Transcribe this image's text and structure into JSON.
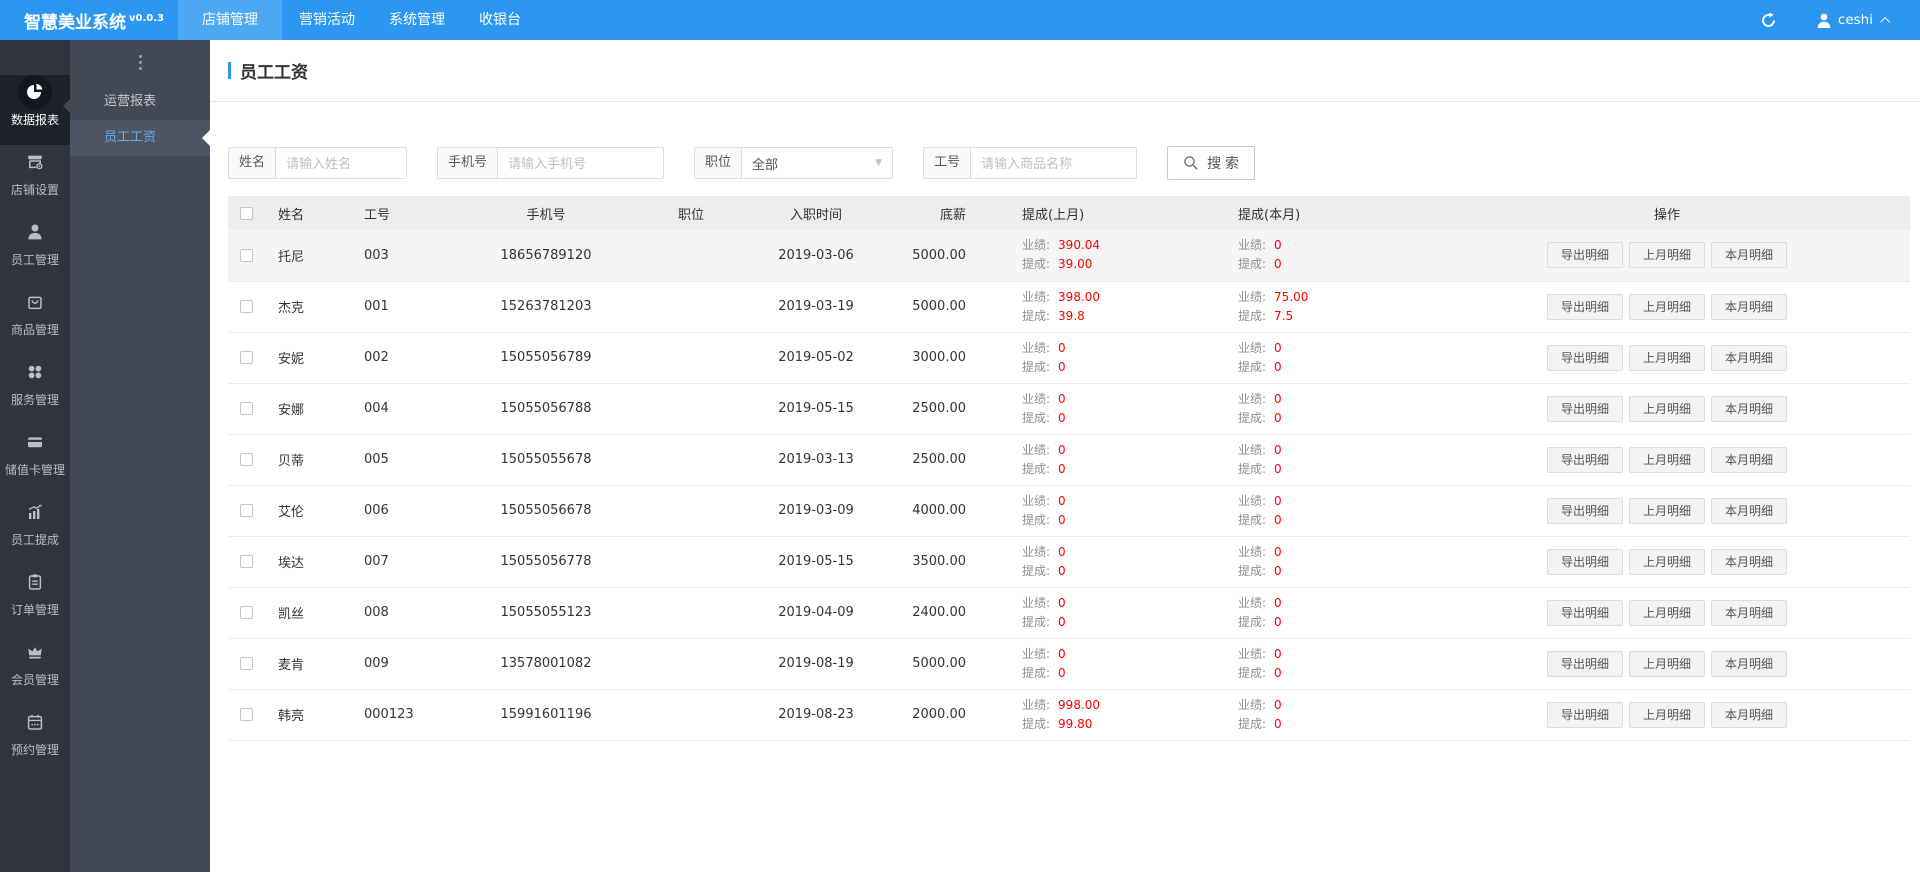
{
  "app": {
    "title": "智慧美业系统",
    "version": "v0.0.3"
  },
  "topnav": {
    "items": [
      {
        "label": "店铺管理",
        "active": true
      },
      {
        "label": "营销活动",
        "active": false
      },
      {
        "label": "系统管理",
        "active": false
      },
      {
        "label": "收银台",
        "active": false
      }
    ]
  },
  "user": {
    "name": "ceshi"
  },
  "sidebar": {
    "items": [
      {
        "label": "数据报表",
        "icon": "pie-chart-icon",
        "active": true
      },
      {
        "label": "店铺设置",
        "icon": "store-icon",
        "active": false
      },
      {
        "label": "员工管理",
        "icon": "staff-person-icon",
        "active": false
      },
      {
        "label": "商品管理",
        "icon": "goods-bag-icon",
        "active": false
      },
      {
        "label": "服务管理",
        "icon": "services-clover-icon",
        "active": false
      },
      {
        "label": "储值卡管理",
        "icon": "stored-card-icon",
        "active": false
      },
      {
        "label": "员工提成",
        "icon": "commission-chart-icon",
        "active": false
      },
      {
        "label": "订单管理",
        "icon": "order-clipboard-icon",
        "active": false
      },
      {
        "label": "会员管理",
        "icon": "member-crown-icon",
        "active": false
      },
      {
        "label": "预约管理",
        "icon": "booking-calendar-icon",
        "active": false
      }
    ]
  },
  "submenu": {
    "items": [
      {
        "label": "运营报表",
        "active": false
      },
      {
        "label": "员工工资",
        "active": true
      }
    ]
  },
  "page": {
    "title": "员工工资"
  },
  "filters": {
    "name": {
      "label": "姓名",
      "placeholder": "请输入姓名"
    },
    "phone": {
      "label": "手机号",
      "placeholder": "请输入手机号"
    },
    "position": {
      "label": "职位",
      "value": "全部"
    },
    "emp_no": {
      "label": "工号",
      "placeholder": "请输入商品名称"
    },
    "search_label": "搜 索"
  },
  "table": {
    "headers": [
      "姓名",
      "工号",
      "手机号",
      "职位",
      "入职时间",
      "底薪",
      "提成(上月)",
      "提成(本月)",
      "操作"
    ],
    "perf_label": "业绩:",
    "comm_label": "提成:",
    "action_labels": [
      "导出明细",
      "上月明细",
      "本月明细"
    ],
    "rows": [
      {
        "name": "托尼",
        "no": "003",
        "phone": "18656789120",
        "position": "",
        "join_date": "2019-03-06",
        "base_salary": "5000.00",
        "last_perf": "390.04",
        "last_comm": "39.00",
        "cur_perf": "0",
        "cur_comm": "0"
      },
      {
        "name": "杰克",
        "no": "001",
        "phone": "15263781203",
        "position": "",
        "join_date": "2019-03-19",
        "base_salary": "5000.00",
        "last_perf": "398.00",
        "last_comm": "39.8",
        "cur_perf": "75.00",
        "cur_comm": "7.5"
      },
      {
        "name": "安妮",
        "no": "002",
        "phone": "15055056789",
        "position": "",
        "join_date": "2019-05-02",
        "base_salary": "3000.00",
        "last_perf": "0",
        "last_comm": "0",
        "cur_perf": "0",
        "cur_comm": "0"
      },
      {
        "name": "安娜",
        "no": "004",
        "phone": "15055056788",
        "position": "",
        "join_date": "2019-05-15",
        "base_salary": "2500.00",
        "last_perf": "0",
        "last_comm": "0",
        "cur_perf": "0",
        "cur_comm": "0"
      },
      {
        "name": "贝蒂",
        "no": "005",
        "phone": "15055055678",
        "position": "",
        "join_date": "2019-03-13",
        "base_salary": "2500.00",
        "last_perf": "0",
        "last_comm": "0",
        "cur_perf": "0",
        "cur_comm": "0"
      },
      {
        "name": "艾伦",
        "no": "006",
        "phone": "15055056678",
        "position": "",
        "join_date": "2019-03-09",
        "base_salary": "4000.00",
        "last_perf": "0",
        "last_comm": "0",
        "cur_perf": "0",
        "cur_comm": "0"
      },
      {
        "name": "埃达",
        "no": "007",
        "phone": "15055056778",
        "position": "",
        "join_date": "2019-05-15",
        "base_salary": "3500.00",
        "last_perf": "0",
        "last_comm": "0",
        "cur_perf": "0",
        "cur_comm": "0"
      },
      {
        "name": "凯丝",
        "no": "008",
        "phone": "15055055123",
        "position": "",
        "join_date": "2019-04-09",
        "base_salary": "2400.00",
        "last_perf": "0",
        "last_comm": "0",
        "cur_perf": "0",
        "cur_comm": "0"
      },
      {
        "name": "麦肯",
        "no": "009",
        "phone": "13578001082",
        "position": "",
        "join_date": "2019-08-19",
        "base_salary": "5000.00",
        "last_perf": "0",
        "last_comm": "0",
        "cur_perf": "0",
        "cur_comm": "0"
      },
      {
        "name": "韩亮",
        "no": "000123",
        "phone": "15991601196",
        "position": "",
        "join_date": "2019-08-23",
        "base_salary": "2000.00",
        "last_perf": "998.00",
        "last_comm": "99.80",
        "cur_perf": "0",
        "cur_comm": "0"
      }
    ]
  },
  "colors": {
    "topbar": "#2b97f1",
    "topbar_active": "#4ea9f4",
    "sidebar_primary": "#303540",
    "sidebar_primary_active": "#1d212a",
    "sidebar_secondary": "#424854",
    "sidebar_secondary_active": "#4d5565",
    "accent": "#2b97f1",
    "value_red": "#ff0000"
  }
}
